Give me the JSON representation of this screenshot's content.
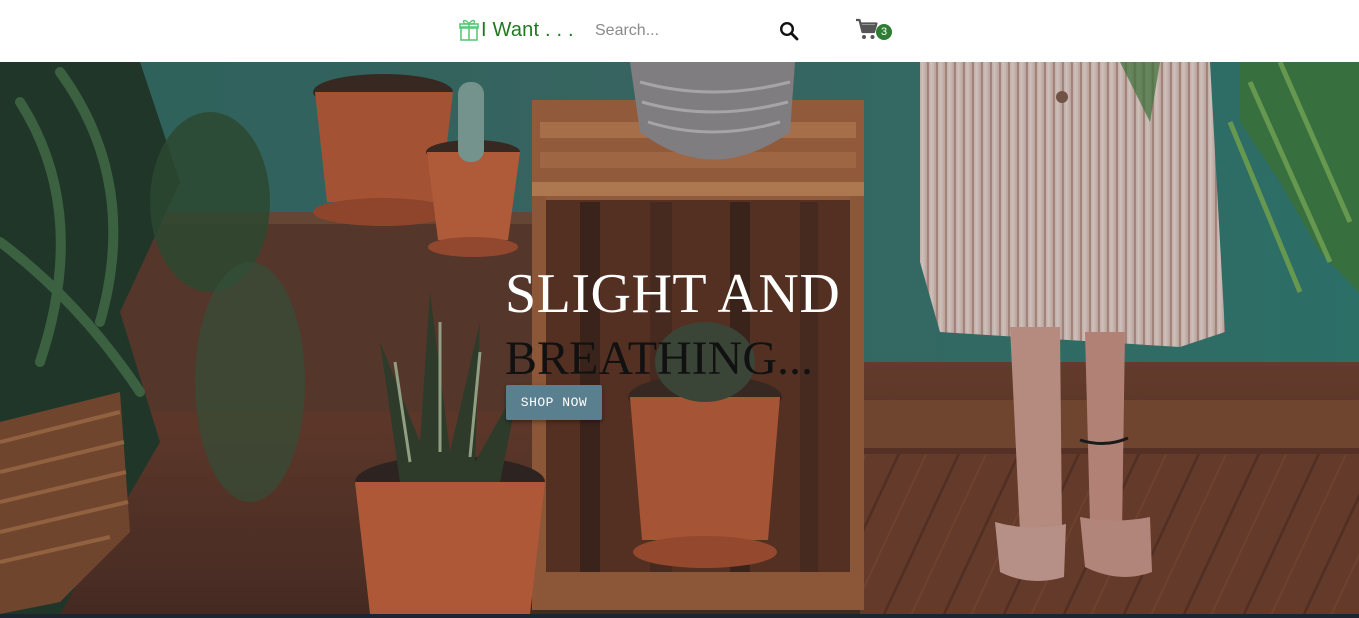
{
  "brand": {
    "name": "I Want . . .",
    "icon": "gift-icon",
    "color": "#1f7a1f"
  },
  "search": {
    "placeholder": "Search...",
    "value": "",
    "icon": "search-icon"
  },
  "cart": {
    "icon": "cart-icon",
    "count": "3",
    "badge_color": "#2e7d32"
  },
  "hero": {
    "title_line1": "SLIGHT AND",
    "title_line2": "BREATHING...",
    "cta_label": "SHOP NOW",
    "cta_color": "#5a7f8e"
  }
}
